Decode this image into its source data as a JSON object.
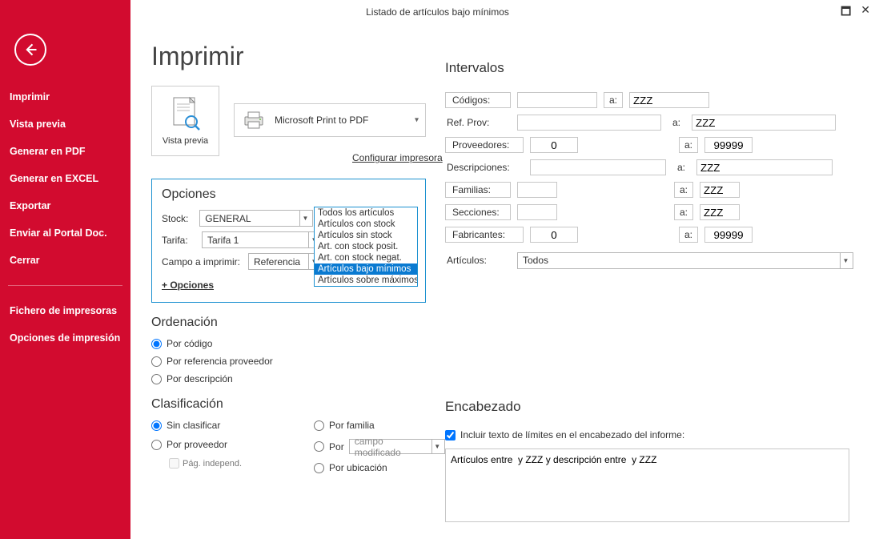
{
  "window": {
    "title": "Listado de artículos bajo mínimos"
  },
  "sidebar": {
    "items": [
      "Imprimir",
      "Vista previa",
      "Generar en PDF",
      "Generar en EXCEL",
      "Exportar",
      "Enviar al Portal Doc.",
      "Cerrar"
    ],
    "items2": [
      "Fichero de impresoras",
      "Opciones de impresión"
    ]
  },
  "page": {
    "title": "Imprimir",
    "preview_label": "Vista previa",
    "printer_name": "Microsoft Print to PDF",
    "config_link": "Configurar impresora"
  },
  "opciones": {
    "heading": "Opciones",
    "stock_label": "Stock:",
    "stock_value": "GENERAL",
    "filter_value": "Artículos bajo mínimo",
    "filter_options": [
      "Todos los artículos",
      "Artículos con stock",
      "Artículos sin stock",
      "Art. con stock posit.",
      "Art. con stock negat.",
      "Artículos bajo mínimos",
      "Artículos sobre máximos"
    ],
    "tarifa_label": "Tarifa:",
    "tarifa_value": "Tarifa 1",
    "campo_label": "Campo a imprimir:",
    "campo_value": "Referencia",
    "mas_opciones": "+ Opciones"
  },
  "ordenacion": {
    "heading": "Ordenación",
    "opt1": "Por código",
    "opt2": "Por referencia proveedor",
    "opt3": "Por descripción"
  },
  "clasificacion": {
    "heading": "Clasificación",
    "sin": "Sin clasificar",
    "prov": "Por proveedor",
    "pag": "Pág. independ.",
    "familia": "Por familia",
    "por": "Por",
    "por_val": "campo modificado",
    "ubic": "Por ubicación"
  },
  "intervalos": {
    "heading": "Intervalos",
    "rows": {
      "codigos": {
        "label": "Códigos:",
        "from": "",
        "to": "ZZZ"
      },
      "refprov": {
        "label": "Ref. Prov:",
        "from": "",
        "to": "ZZZ"
      },
      "proveedores": {
        "label": "Proveedores:",
        "from": "0",
        "to": "99999"
      },
      "descripciones": {
        "label": "Descripciones:",
        "from": "",
        "to": "ZZZ"
      },
      "familias": {
        "label": "Familias:",
        "from": "",
        "to": "ZZZ"
      },
      "secciones": {
        "label": "Secciones:",
        "from": "",
        "to": "ZZZ"
      },
      "fabricantes": {
        "label": "Fabricantes:",
        "from": "0",
        "to": "99999"
      }
    },
    "a": "a:",
    "articulos_label": "Artículos:",
    "articulos_value": "Todos"
  },
  "encabezado": {
    "heading": "Encabezado",
    "chk_label": "Incluir texto de límites en el encabezado del informe:",
    "text": "Artículos entre  y ZZZ y descripción entre  y ZZZ"
  }
}
